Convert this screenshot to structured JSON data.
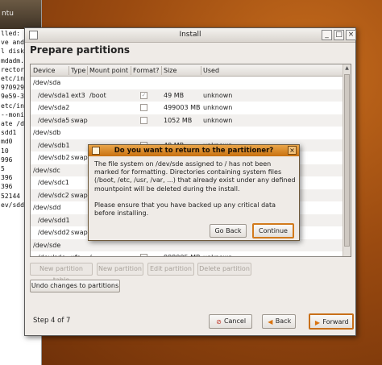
{
  "terminal": {
    "title": "ntu",
    "lines": [
      "",
      "lled:",
      "",
      "ve and",
      "",
      "l disk",
      "",
      "mdadm.",
      "rector",
      "etc/in",
      "970929",
      "",
      "9e59-3",
      "etc/in",
      "--moni",
      "",
      "ate /d",
      "sdd1",
      "",
      "",
      "md0",
      "10",
      "996",
      "5",
      "396",
      "396",
      "52144",
      "ev/sdd"
    ]
  },
  "window": {
    "title": "Install",
    "heading": "Prepare partitions",
    "controls": [
      "_",
      "□",
      "×"
    ]
  },
  "table": {
    "columns": [
      "Device",
      "Type",
      "Mount point",
      "Format?",
      "Size",
      "Used"
    ],
    "rows": [
      {
        "device": "/dev/sda",
        "type": "",
        "mount": "",
        "format": null,
        "size": "",
        "used": ""
      },
      {
        "device": "/dev/sda1",
        "type": "ext3",
        "mount": "/boot",
        "format": true,
        "size": "49 MB",
        "used": "unknown"
      },
      {
        "device": "/dev/sda2",
        "type": "",
        "mount": "",
        "format": false,
        "size": "499003 MB",
        "used": "unknown"
      },
      {
        "device": "/dev/sda5",
        "type": "swap",
        "mount": "",
        "format": false,
        "size": "1052 MB",
        "used": "unknown"
      },
      {
        "device": "/dev/sdb",
        "type": "",
        "mount": "",
        "format": null,
        "size": "",
        "used": ""
      },
      {
        "device": "/dev/sdb1",
        "type": "",
        "mount": "",
        "format": false,
        "size": "49 MB",
        "used": "unknown"
      },
      {
        "device": "/dev/sdb2",
        "type": "swap",
        "mount": "",
        "format": false,
        "size": "",
        "used": ""
      },
      {
        "device": "/dev/sdc",
        "type": "",
        "mount": "",
        "format": null,
        "size": "",
        "used": ""
      },
      {
        "device": "/dev/sdc1",
        "type": "",
        "mount": "",
        "format": false,
        "size": "",
        "used": ""
      },
      {
        "device": "/dev/sdc2",
        "type": "swap",
        "mount": "",
        "format": false,
        "size": "",
        "used": ""
      },
      {
        "device": "/dev/sdd",
        "type": "",
        "mount": "",
        "format": null,
        "size": "",
        "used": ""
      },
      {
        "device": "/dev/sdd1",
        "type": "",
        "mount": "",
        "format": false,
        "size": "",
        "used": ""
      },
      {
        "device": "/dev/sdd2",
        "type": "swap",
        "mount": "",
        "format": false,
        "size": "",
        "used": ""
      },
      {
        "device": "/dev/sde",
        "type": "",
        "mount": "",
        "format": null,
        "size": "",
        "used": ""
      },
      {
        "device": "/dev/sde",
        "type": "xfs",
        "mount": "/",
        "format": false,
        "size": "998005 MB",
        "used": "unknown"
      }
    ]
  },
  "actions": {
    "new_table": "New partition table",
    "new_partition": "New partition",
    "edit_partition": "Edit partition",
    "delete_partition": "Delete partition",
    "undo": "Undo changes to partitions"
  },
  "footer": {
    "step": "Step 4 of 7",
    "cancel": "Cancel",
    "back": "Back",
    "forward": "Forward"
  },
  "dialog": {
    "title": "Do you want to return to the partitioner?",
    "message1": "The file system on /dev/sde assigned to / has not been marked for formatting.  Directories containing system files (/boot, /etc, /usr, /var, ...) that already exist under any defined mountpoint will be deleted during the install.",
    "message2": "Please ensure that you have backed up any critical data before installing.",
    "go_back": "Go Back",
    "continue": "Continue"
  },
  "colors": {
    "dialog_title": "#d98a2a",
    "background": "#9a4a10"
  }
}
